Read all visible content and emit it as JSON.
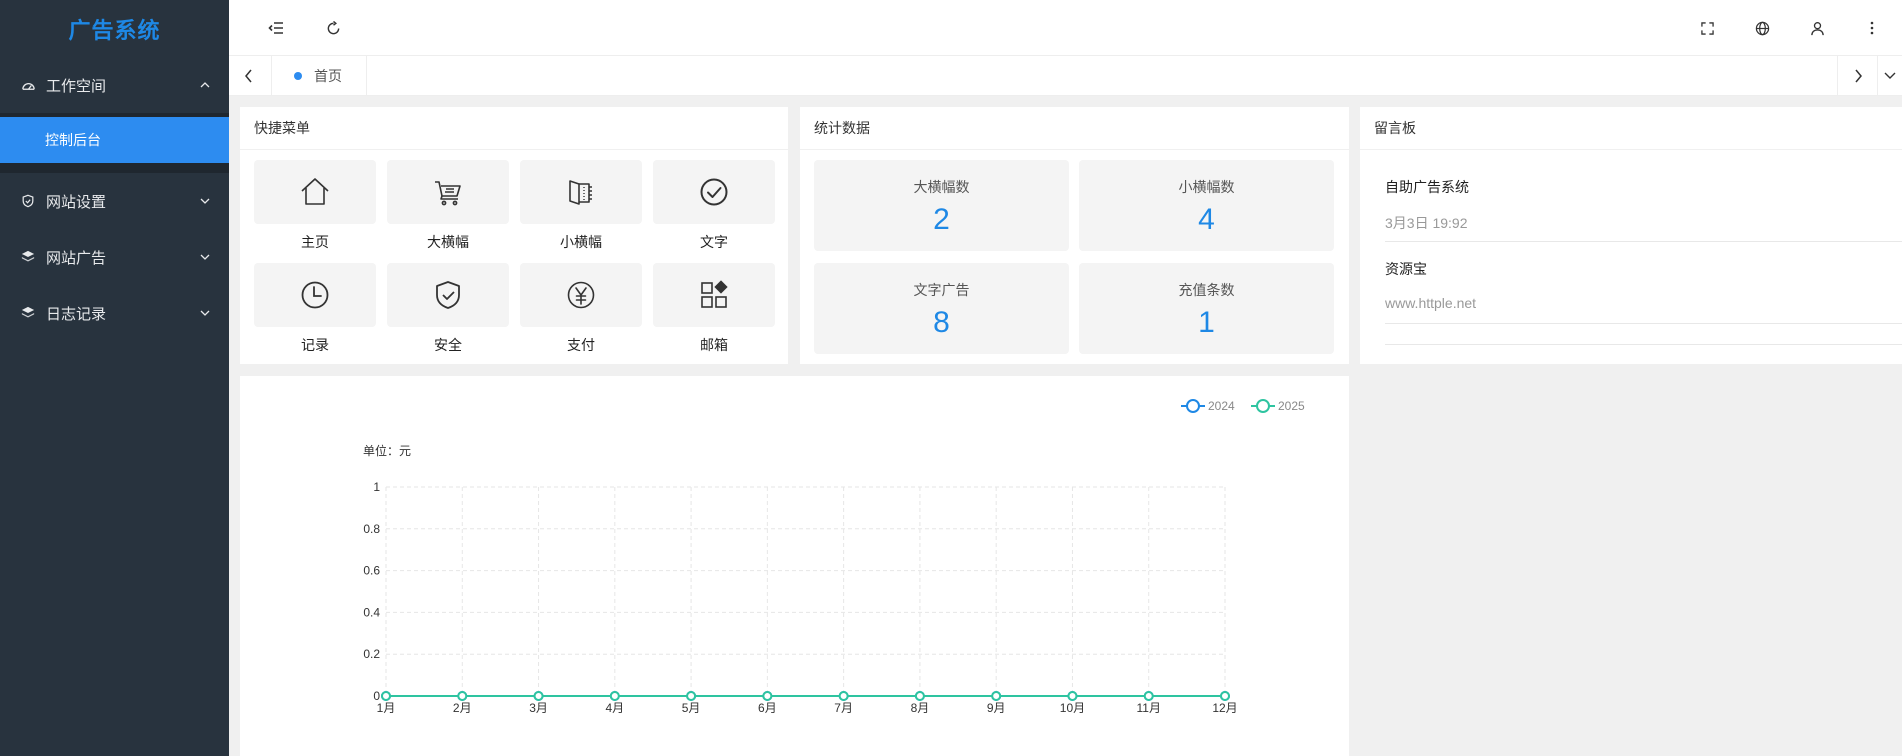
{
  "app": {
    "title": "广告系统"
  },
  "sidebar": {
    "groups": [
      {
        "label": "工作空间",
        "icon": "dashboard-icon",
        "expanded": true,
        "children": [
          {
            "label": "控制后台",
            "active": true
          }
        ]
      },
      {
        "label": "网站设置",
        "icon": "shield-check-icon",
        "expanded": false
      },
      {
        "label": "网站广告",
        "icon": "layers-icon",
        "expanded": false
      },
      {
        "label": "日志记录",
        "icon": "layers-icon",
        "expanded": false
      }
    ]
  },
  "header": {
    "icons": [
      "menu-fold-icon",
      "refresh-icon",
      "fullscreen-icon",
      "globe-icon",
      "user-icon",
      "more-icon"
    ]
  },
  "tabs": {
    "items": [
      {
        "label": "首页",
        "active": true
      }
    ]
  },
  "quick_menu": {
    "title": "快捷菜单",
    "items": [
      {
        "label": "主页",
        "icon": "home-icon"
      },
      {
        "label": "大横幅",
        "icon": "cart-icon"
      },
      {
        "label": "小横幅",
        "icon": "book-icon"
      },
      {
        "label": "文字",
        "icon": "check-circle-icon"
      },
      {
        "label": "记录",
        "icon": "clock-icon"
      },
      {
        "label": "安全",
        "icon": "shield-check-icon"
      },
      {
        "label": "支付",
        "icon": "yen-icon"
      },
      {
        "label": "邮箱",
        "icon": "apps-icon"
      }
    ]
  },
  "stats": {
    "title": "统计数据",
    "items": [
      {
        "label": "大横幅数",
        "value": "2"
      },
      {
        "label": "小横幅数",
        "value": "4"
      },
      {
        "label": "文字广告",
        "value": "8"
      },
      {
        "label": "充值条数",
        "value": "1"
      }
    ],
    "accent": "#1e88e5"
  },
  "messages": {
    "title": "留言板",
    "items": [
      {
        "title": "自助广告系统",
        "sub": "3月3日 19:92"
      },
      {
        "title": "资源宝",
        "sub": "www.httple.net"
      }
    ]
  },
  "chart_data": {
    "type": "line",
    "ylabel": "单位：元",
    "categories": [
      "1月",
      "2月",
      "3月",
      "4月",
      "5月",
      "6月",
      "7月",
      "8月",
      "9月",
      "10月",
      "11月",
      "12月"
    ],
    "yticks": [
      "0",
      "0.2",
      "0.4",
      "0.6",
      "0.8",
      "1"
    ],
    "ylim": [
      0,
      1
    ],
    "grid": true,
    "legend_position": "top-right",
    "series": [
      {
        "name": "2024",
        "values": [
          0,
          0,
          0,
          0,
          0,
          0,
          0,
          0,
          0,
          0,
          0,
          0
        ],
        "color": "#1e88e5"
      },
      {
        "name": "2025",
        "values": [
          0,
          0,
          0,
          0,
          0,
          0,
          0,
          0,
          0,
          0,
          0,
          0
        ],
        "color": "#2ec4a0"
      }
    ]
  }
}
